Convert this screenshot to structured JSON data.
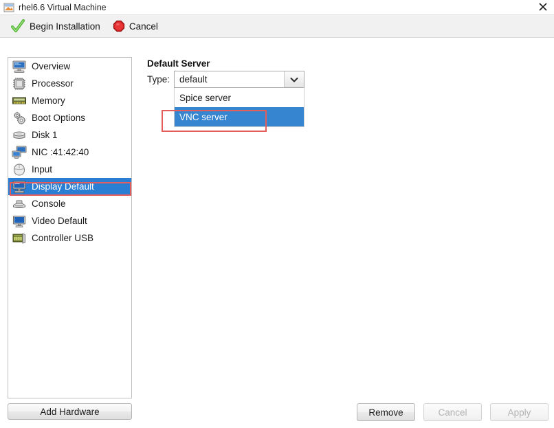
{
  "window": {
    "title": "rhel6.6 Virtual Machine",
    "icon": "vm-window-icon",
    "close_icon": "close-icon"
  },
  "toolbar": {
    "begin_installation_label": "Begin Installation",
    "begin_installation_icon": "green-check-icon",
    "cancel_label": "Cancel",
    "cancel_icon": "red-stop-icon"
  },
  "sidebar": {
    "items": [
      {
        "label": "Overview",
        "icon": "monitor-icon",
        "selected": false
      },
      {
        "label": "Processor",
        "icon": "cpu-chip-icon",
        "selected": false
      },
      {
        "label": "Memory",
        "icon": "memory-stick-icon",
        "selected": false
      },
      {
        "label": "Boot Options",
        "icon": "gears-icon",
        "selected": false
      },
      {
        "label": "Disk 1",
        "icon": "hard-disk-icon",
        "selected": false
      },
      {
        "label": "NIC :41:42:40",
        "icon": "network-card-icon",
        "selected": false
      },
      {
        "label": "Input",
        "icon": "mouse-icon",
        "selected": false
      },
      {
        "label": "Display Default",
        "icon": "display-icon",
        "selected": true
      },
      {
        "label": "Console",
        "icon": "console-icon",
        "selected": false
      },
      {
        "label": "Video Default",
        "icon": "video-monitor-icon",
        "selected": false
      },
      {
        "label": "Controller USB",
        "icon": "usb-controller-icon",
        "selected": false
      }
    ],
    "add_hardware_label": "Add Hardware"
  },
  "main": {
    "section_title": "Default Server",
    "type_label": "Type:",
    "type_value": "default",
    "type_dropdown_icon": "chevron-down-icon",
    "type_options": [
      {
        "label": "Spice server",
        "highlighted": false
      },
      {
        "label": "VNC server",
        "highlighted": true
      }
    ]
  },
  "footer": {
    "remove_label": "Remove",
    "remove_disabled": false,
    "cancel_label": "Cancel",
    "cancel_disabled": true,
    "apply_label": "Apply",
    "apply_disabled": true
  },
  "annotations": {
    "vnc_server_highlight": "red-rectangle-vnc-server",
    "display_default_highlight": "red-rectangle-display-default"
  },
  "colors": {
    "selection_blue": "#2a7fd4",
    "dropdown_highlight_blue": "#3585d0",
    "annotation_red": "#e35d5d",
    "toolbar_bg": "#f1f1f1"
  }
}
